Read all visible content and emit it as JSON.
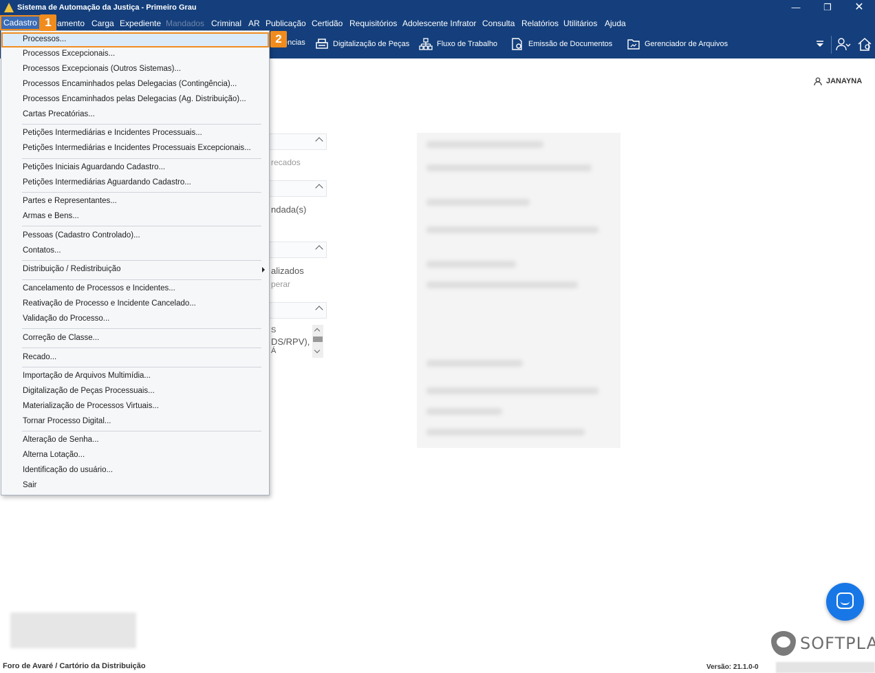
{
  "window": {
    "title": "Sistema de Automação da Justiça - Primeiro Grau",
    "min": "—",
    "max": "❐",
    "close": "✕"
  },
  "menubar": [
    {
      "label": "Cadastro",
      "disabled": false
    },
    {
      "label": "amento",
      "disabled": false
    },
    {
      "label": "Carga",
      "disabled": false
    },
    {
      "label": "Expediente",
      "disabled": false
    },
    {
      "label": "Mandados",
      "disabled": true
    },
    {
      "label": "Criminal",
      "disabled": false
    },
    {
      "label": "AR",
      "disabled": false
    },
    {
      "label": "Publicação",
      "disabled": false
    },
    {
      "label": "Certidão",
      "disabled": false
    },
    {
      "label": "Requisitórios",
      "disabled": false
    },
    {
      "label": "Adolescente Infrator",
      "disabled": false
    },
    {
      "label": "Consulta",
      "disabled": false
    },
    {
      "label": "Relatórios",
      "disabled": false
    },
    {
      "label": "Utilitários",
      "disabled": false
    },
    {
      "label": "Ajuda",
      "disabled": false
    }
  ],
  "toolbar": {
    "partial": "ências",
    "digitalizacao": "Digitalização de Peças",
    "fluxo": "Fluxo de Trabalho",
    "emissao": "Emissão de Documentos",
    "gerenciador": "Gerenciador de Arquivos"
  },
  "user": {
    "name": "JANAYNA"
  },
  "peek": {
    "recados": "recados",
    "ndada": "ndada(s)",
    "alizados": "alizados",
    "perar": "perar",
    "s": "S",
    "ds": "DS/RPV),",
    "a": "Á"
  },
  "dropdown": {
    "items": [
      "Processos...",
      "Processos Excepcionais...",
      "Processos Excepcionais (Outros Sistemas)...",
      "Processos Encaminhados pelas Delegacias (Contingência)...",
      "Processos Encaminhados pelas Delegacias (Ag. Distribuição)...",
      "Cartas Precatórias...",
      "Petições Intermediárias e Incidentes Processuais...",
      "Petições Intermediárias e Incidentes Processuais Excepcionais...",
      "Petições Iniciais Aguardando Cadastro...",
      "Petições Intermediárias Aguardando Cadastro...",
      "Partes e Representantes...",
      "Armas e Bens...",
      "Pessoas (Cadastro Controlado)...",
      "Contatos...",
      "Distribuição / Redistribuição",
      "Cancelamento de Processos e Incidentes...",
      "Reativação de Processo e Incidente Cancelado...",
      "Validação do Processo...",
      "Correção de Classe...",
      "Recado...",
      "Importação de Arquivos Multimídia...",
      "Digitalização de Peças Processuais...",
      "Materialização de Processos Virtuais...",
      "Tornar Processo Digital...",
      "Alteração de Senha...",
      "Alterna Lotação...",
      "Identificação do usuário...",
      "Sair"
    ]
  },
  "badges": {
    "one": "1",
    "two": "2"
  },
  "status": {
    "left": "Foro de Avaré / Cartório da Distribuição",
    "version": "Versão: 21.1.0-0"
  },
  "brand": {
    "name": "SOFTPLAN"
  },
  "colors": {
    "titlebar": "#143f7c",
    "accent": "#f08c1e",
    "fab": "#1877e6"
  }
}
